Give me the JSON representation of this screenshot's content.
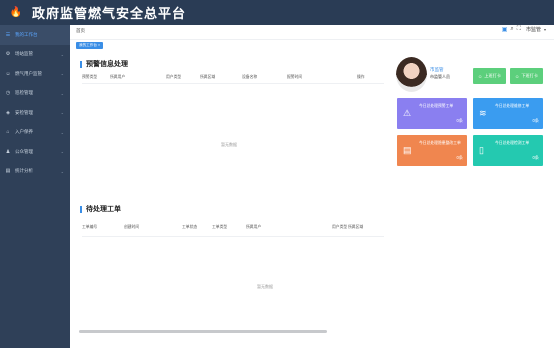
{
  "app": {
    "title": "政府监管燃气安全总平台"
  },
  "sidebar": {
    "items": [
      {
        "label": "我的工作台",
        "icon": "list-icon"
      },
      {
        "label": "场站监管",
        "icon": "gear-icon"
      },
      {
        "label": "燃气用户监管",
        "icon": "user-icon"
      },
      {
        "label": "巡检管理",
        "icon": "clock-icon"
      },
      {
        "label": "安检管理",
        "icon": "shield-icon"
      },
      {
        "label": "入户保养",
        "icon": "home-icon"
      },
      {
        "label": "公众管理",
        "icon": "people-icon"
      },
      {
        "label": "统计分析",
        "icon": "chart-icon"
      }
    ]
  },
  "header": {
    "breadcrumb": "首页",
    "user": "市监管"
  },
  "tabs": [
    {
      "label": "我的工作台 ×"
    }
  ],
  "warning": {
    "title": "预警信息处理",
    "columns": [
      "预警类型",
      "所属用户",
      "用户类型",
      "所属区域",
      "设备名称",
      "报警时间",
      "操作"
    ],
    "empty": "暂无数据"
  },
  "pending": {
    "title": "待处理工单",
    "columns": [
      "工单编号",
      "创建时间",
      "工单状态",
      "工单类型",
      "所属用户",
      "用户类型",
      "所属区域"
    ],
    "empty": "暂无数据"
  },
  "profile": {
    "name": "市监管",
    "role": "市监管人员"
  },
  "buttons": {
    "clock_in": "上班打卡",
    "clock_out": "下班打卡"
  },
  "cards": [
    {
      "title": "今日总处理预警工单",
      "value": "0条",
      "color": "#8a7ff0"
    },
    {
      "title": "今日总处理维修工单",
      "value": "0条",
      "color": "#3a9cf0"
    },
    {
      "title": "今日总处理隐患整改工单",
      "value": "0条",
      "color": "#f0864f"
    },
    {
      "title": "今日总处理检测工单",
      "value": "0条",
      "color": "#24c9b0"
    }
  ]
}
